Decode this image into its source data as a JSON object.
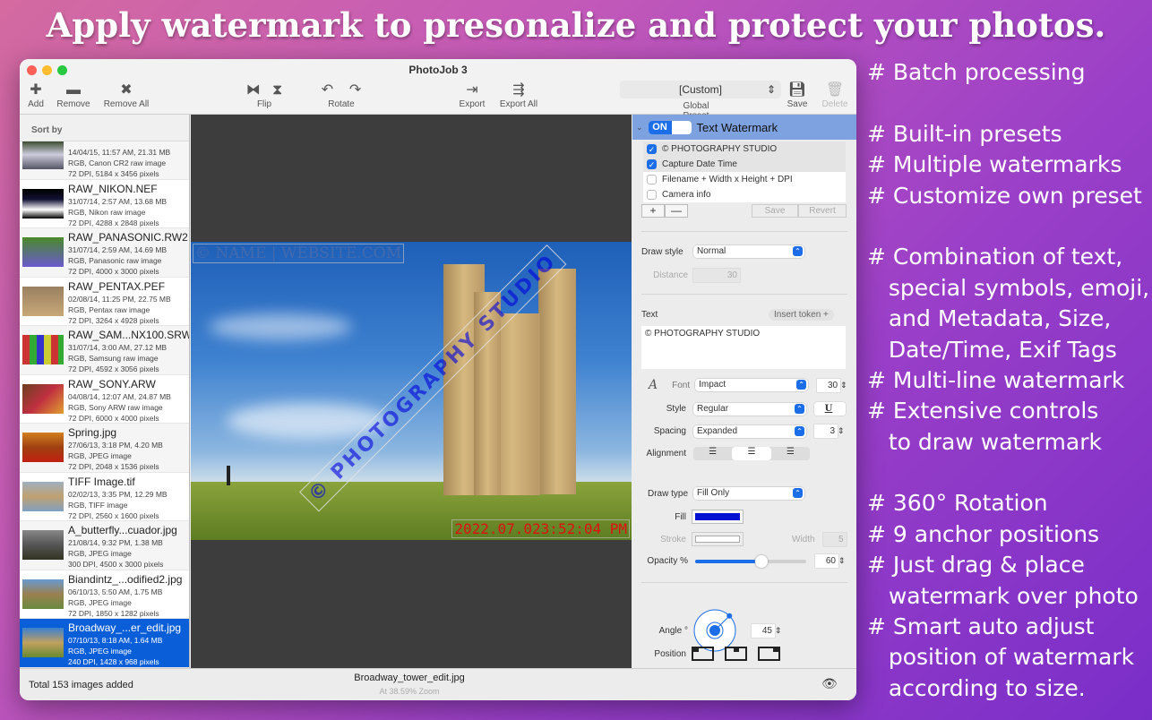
{
  "headline": "Apply watermark to presonalize and protect your photos.",
  "features": [
    "# Batch processing",
    "",
    "# Built-in presets",
    "# Multiple watermarks",
    "# Customize own preset",
    "",
    "# Combination of text,",
    "   special symbols, emoji,",
    "   and Metadata, Size,",
    "   Date/Time, Exif Tags",
    "# Multi-line watermark",
    "# Extensive controls",
    "   to draw watermark",
    "",
    "# 360° Rotation",
    "# 9 anchor positions",
    "# Just drag & place",
    "   watermark over photo",
    "# Smart auto adjust",
    "   position of watermark",
    "   according to size."
  ],
  "window": {
    "title": "PhotoJob 3"
  },
  "toolbar": {
    "add": "Add",
    "remove": "Remove",
    "remove_all": "Remove All",
    "flip": "Flip",
    "rotate": "Rotate",
    "export": "Export",
    "export_all": "Export All",
    "preset_value": "[Custom]",
    "preset_label": "Global Preset",
    "save": "Save",
    "delete": "Delete"
  },
  "sidebar": {
    "sort_by": "Sort by",
    "items": [
      {
        "name": "",
        "l1": "14/04/15, 11:57 AM, 21.31 MB",
        "l2": "RGB, Canon CR2 raw image",
        "l3": "72 DPI, 5184 x 3456 pixels"
      },
      {
        "name": "RAW_NIKON.NEF",
        "l1": "31/07/14, 2:57 AM, 13.68 MB",
        "l2": "RGB, Nikon raw image",
        "l3": "72 DPI, 4288 x 2848 pixels"
      },
      {
        "name": "RAW_PANASONIC.RW2",
        "l1": "31/07/14, 2:59 AM, 14.69 MB",
        "l2": "RGB, Panasonic raw image",
        "l3": "72 DPI, 4000 x 3000 pixels"
      },
      {
        "name": "RAW_PENTAX.PEF",
        "l1": "02/08/14, 11:25 PM, 22.75 MB",
        "l2": "RGB, Pentax raw image",
        "l3": "72 DPI, 3264 x 4928 pixels"
      },
      {
        "name": "RAW_SAM...NX100.SRW",
        "l1": "31/07/14, 3:00 AM, 27.12 MB",
        "l2": "RGB, Samsung raw image",
        "l3": "72 DPI, 4592 x 3056 pixels"
      },
      {
        "name": "RAW_SONY.ARW",
        "l1": "04/08/14, 12:07 AM, 24.87 MB",
        "l2": "RGB, Sony ARW raw image",
        "l3": "72 DPI, 6000 x 4000 pixels"
      },
      {
        "name": "Spring.jpg",
        "l1": "27/06/13, 3:18 PM, 4.20 MB",
        "l2": "RGB, JPEG image",
        "l3": "72 DPI, 2048 x 1536 pixels"
      },
      {
        "name": "TIFF Image.tif",
        "l1": "02/02/13, 3:35 PM, 12.29 MB",
        "l2": "RGB, TIFF image",
        "l3": "72 DPI, 2560 x 1600 pixels"
      },
      {
        "name": "A_butterfly...cuador.jpg",
        "l1": "21/08/14, 9:32 PM, 1.38 MB",
        "l2": "RGB, JPEG image",
        "l3": "300 DPI, 4500 x 3000 pixels"
      },
      {
        "name": "Biandintz_...odified2.jpg",
        "l1": "06/10/13, 5:50 AM, 1.75 MB",
        "l2": "RGB, JPEG image",
        "l3": "72 DPI, 1850 x 1282 pixels"
      },
      {
        "name": "Broadway_...er_edit.jpg",
        "l1": "07/10/13, 8:18 AM, 1.64 MB",
        "l2": "RGB, JPEG image",
        "l3": "240 DPI, 1428 x 968 pixels"
      }
    ]
  },
  "canvas": {
    "wm_name": "© NAME | WEBSITE.COM",
    "wm_studio": "© PHOTOGRAPHY STUDIO",
    "wm_date": "2022.07.023:52:04 PM"
  },
  "inspector": {
    "on": "ON",
    "title": "Text Watermark",
    "watermarks": [
      {
        "label": "© PHOTOGRAPHY STUDIO",
        "checked": true
      },
      {
        "label": "Capture Date Time",
        "checked": true
      },
      {
        "label": "Filename + Width x Height + DPI",
        "checked": false
      },
      {
        "label": "Camera info",
        "checked": false
      }
    ],
    "plus": "+",
    "minus": "—",
    "save": "Save",
    "revert": "Revert",
    "draw_style_label": "Draw style",
    "draw_style": "Normal",
    "distance_label": "Distance",
    "distance": "30",
    "text_label": "Text",
    "insert_token": "Insert token +",
    "text_value": "© PHOTOGRAPHY STUDIO",
    "font_label": "Font",
    "font": "Impact",
    "font_size": "30",
    "style_label": "Style",
    "style": "Regular",
    "underline": "U",
    "spacing_label": "Spacing",
    "spacing": "Expanded",
    "spacing_value": "3",
    "alignment_label": "Alignment",
    "draw_type_label": "Draw type",
    "draw_type": "Fill Only",
    "fill_label": "Fill",
    "fill_color": "#0010d0",
    "stroke_label": "Stroke",
    "width_label": "Width",
    "stroke_width": "5",
    "opacity_label": "Opacity %",
    "opacity": "60",
    "angle_label": "Angle °",
    "angle": "45",
    "position_label": "Position"
  },
  "status": {
    "total": "Total 153 images added",
    "filename": "Broadway_tower_edit.jpg",
    "zoom": "At 38.59% Zoom"
  }
}
